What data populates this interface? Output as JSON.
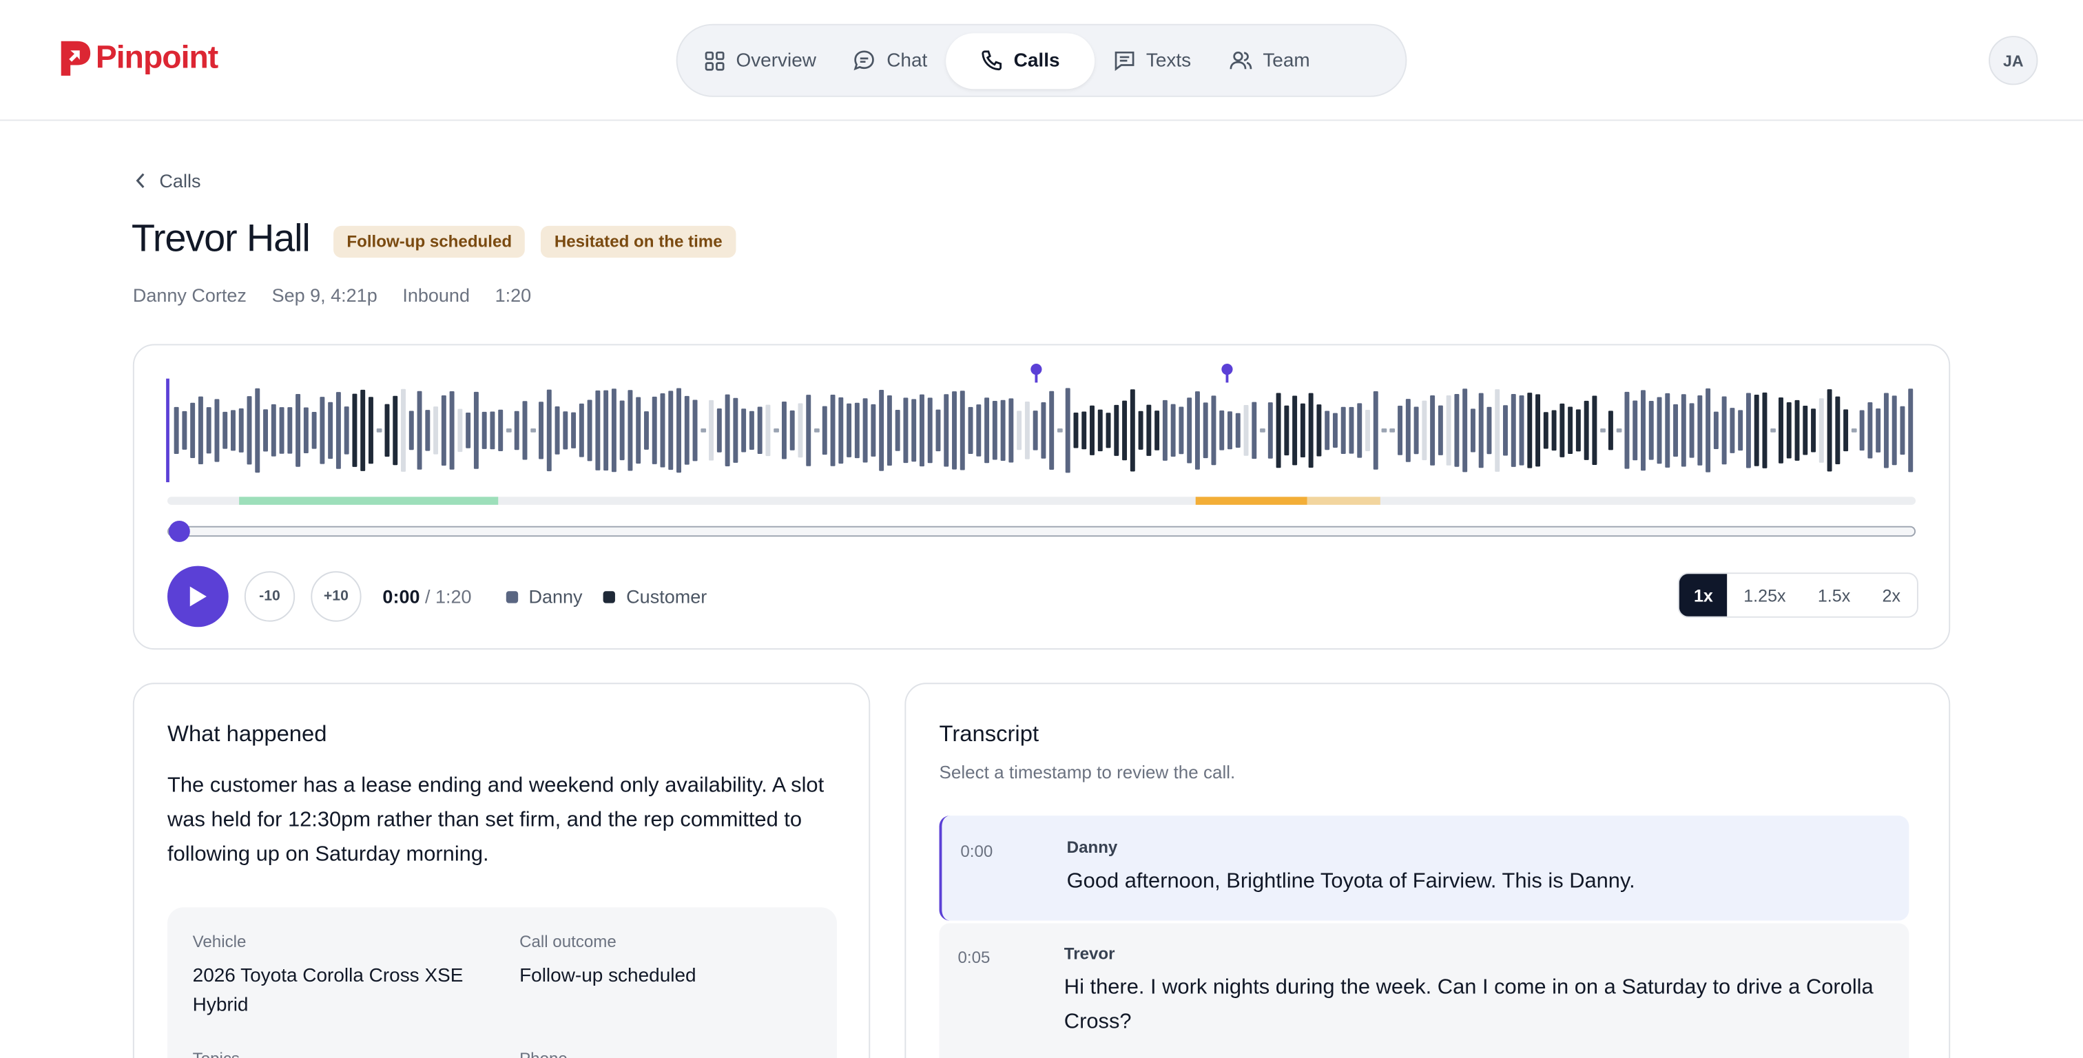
{
  "brand": {
    "name": "Pinpoint",
    "color": "#dc2633"
  },
  "nav": {
    "items": [
      {
        "label": "Overview",
        "icon": "grid-icon"
      },
      {
        "label": "Chat",
        "icon": "chat-bubble-icon"
      },
      {
        "label": "Calls",
        "icon": "phone-icon",
        "active": true
      },
      {
        "label": "Texts",
        "icon": "message-square-icon"
      },
      {
        "label": "Team",
        "icon": "users-icon"
      }
    ]
  },
  "user": {
    "initials": "JA"
  },
  "breadcrumb": {
    "back_label": "Calls"
  },
  "call": {
    "title": "Trevor Hall",
    "badges": [
      "Follow-up scheduled",
      "Hesitated on the time"
    ],
    "meta": {
      "rep": "Danny Cortez",
      "date": "Sep 9, 4:21p",
      "direction": "Inbound",
      "duration": "1:20"
    }
  },
  "player": {
    "current_time": "0:00",
    "total_time": "1:20",
    "progress": 0,
    "skip_back_label": "-10",
    "skip_forward_label": "+10",
    "legend": [
      {
        "label": "Danny",
        "color": "#5a6682"
      },
      {
        "label": "Customer",
        "color": "#1f2937"
      }
    ],
    "speeds": [
      "1x",
      "1.25x",
      "1.5x",
      "2x"
    ],
    "active_speed": "1x",
    "accent": "#5b40d6",
    "segments": [
      {
        "start": 0.041,
        "end": 0.189,
        "color": "#9ddfba"
      },
      {
        "start": 0.588,
        "end": 0.652,
        "color": "#f3ae37"
      },
      {
        "start": 0.652,
        "end": 0.694,
        "color": "#f2d59e"
      }
    ],
    "markers": [
      0.497,
      0.606
    ]
  },
  "summary": {
    "heading": "What happened",
    "text": "The customer has a lease ending and weekend only availability. A slot was held for 12:30pm rather than set firm, and the rep committed to following up on Saturday morning.",
    "facts": [
      {
        "label": "Vehicle",
        "value": "2026 Toyota Corolla Cross XSE Hybrid"
      },
      {
        "label": "Call outcome",
        "value": "Follow-up scheduled"
      },
      {
        "label": "Topics",
        "value": ""
      },
      {
        "label": "Phone",
        "value": ""
      }
    ]
  },
  "transcript": {
    "heading": "Transcript",
    "subtitle": "Select a timestamp to review the call.",
    "lines": [
      {
        "time": "0:00",
        "speaker": "Danny",
        "text": "Good afternoon, Brightline Toyota of Fairview. This is Danny.",
        "active": true
      },
      {
        "time": "0:05",
        "speaker": "Trevor",
        "text": "Hi there. I work nights during the week. Can I come in on a Saturday to drive a Corolla Cross?"
      }
    ]
  }
}
